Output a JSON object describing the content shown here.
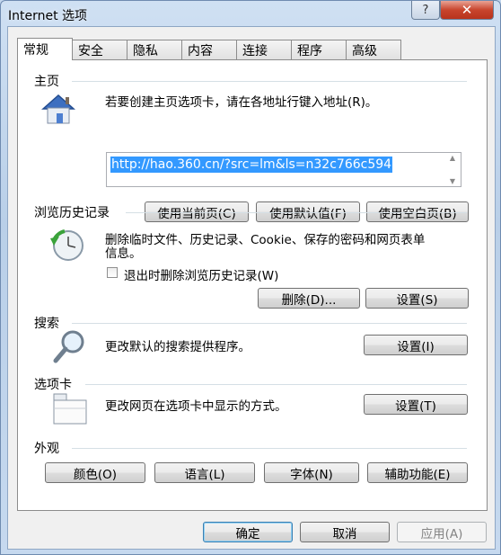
{
  "window": {
    "title": "Internet 选项",
    "help_glyph": "?",
    "close_glyph": "✕"
  },
  "tabs": [
    "常规",
    "安全",
    "隐私",
    "内容",
    "连接",
    "程序",
    "高级"
  ],
  "homepage": {
    "heading": "主页",
    "description": "若要创建主页选项卡，请在各地址行键入地址(R)。",
    "url": "http://hao.360.cn/?src=lm&ls=n32c766c594",
    "btn_current": "使用当前页(C)",
    "btn_default": "使用默认值(F)",
    "btn_blank": "使用空白页(B)"
  },
  "history": {
    "heading": "浏览历史记录",
    "description_line1": "删除临时文件、历史记录、Cookie、保存的密码和网页表单",
    "description_line2": "信息。",
    "checkbox_label": "退出时删除浏览历史记录(W)",
    "checkbox_checked": false,
    "btn_delete": "删除(D)...",
    "btn_settings": "设置(S)"
  },
  "search": {
    "heading": "搜索",
    "description": "更改默认的搜索提供程序。",
    "btn_settings": "设置(I)"
  },
  "tabs_section": {
    "heading": "选项卡",
    "description": "更改网页在选项卡中显示的方式。",
    "btn_settings": "设置(T)"
  },
  "appearance": {
    "heading": "外观",
    "btn_colors": "颜色(O)",
    "btn_languages": "语言(L)",
    "btn_fonts": "字体(N)",
    "btn_accessibility": "辅助功能(E)"
  },
  "footer": {
    "ok": "确定",
    "cancel": "取消",
    "apply": "应用(A)"
  }
}
